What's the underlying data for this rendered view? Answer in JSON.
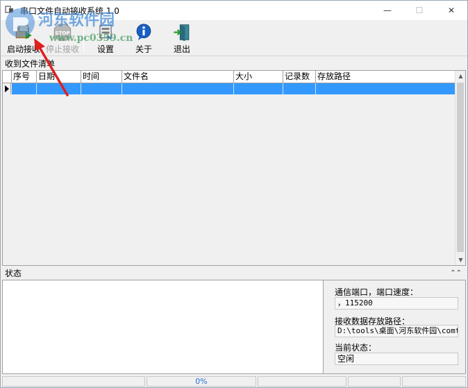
{
  "window": {
    "title": "串口文件自动接收系统 1.0",
    "controls": {
      "minimize": "—",
      "maximize": "☐",
      "close": "✕"
    }
  },
  "watermark": {
    "text": "河东软件园",
    "url": "www.pc0359.cn"
  },
  "toolbar": {
    "buttons": [
      {
        "label": "启动接收",
        "icon": "start-receive-icon",
        "enabled": true
      },
      {
        "label": "停止接收",
        "icon": "stop-icon",
        "enabled": false
      },
      {
        "label": "设置",
        "icon": "settings-icon",
        "enabled": true
      },
      {
        "label": "关于",
        "icon": "info-icon",
        "enabled": true
      },
      {
        "label": "退出",
        "icon": "exit-icon",
        "enabled": true
      }
    ]
  },
  "file_list": {
    "title": "收到文件清单",
    "columns": [
      "序号",
      "日期",
      "时间",
      "文件名",
      "大小",
      "记录数",
      "存放路径"
    ],
    "rows": [
      {
        "selected": true,
        "cells": [
          "",
          "",
          "",
          "",
          "",
          "",
          ""
        ]
      }
    ]
  },
  "status": {
    "title": "状态",
    "collapse_icon": "double-chevron-up-icon",
    "port_label": "通信端口，端口速度：",
    "port_value": "，115200",
    "path_label": "接收数据存放路径：",
    "path_value": "D:\\tools\\桌面\\河东软件园\\comtool",
    "state_label": "当前状态：",
    "state_value": "空闲"
  },
  "statusbar": {
    "progress": "0%"
  },
  "colors": {
    "selection": "#3399ff",
    "arrow": "#e02020"
  }
}
